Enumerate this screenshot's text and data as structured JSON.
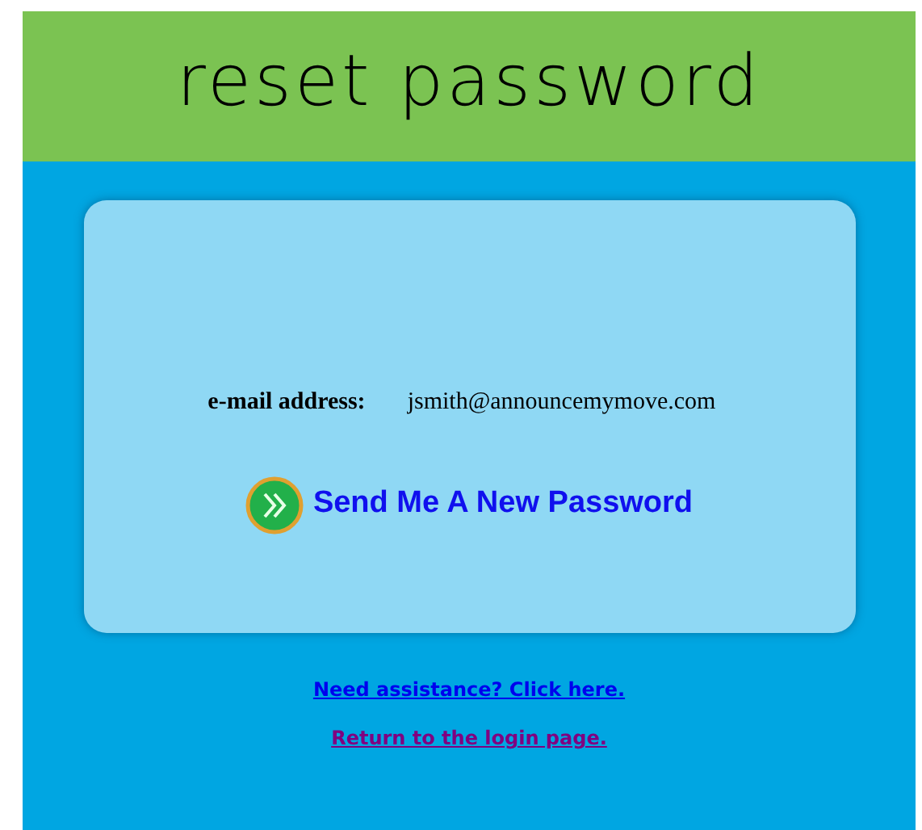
{
  "header": {
    "title": "reset password"
  },
  "form": {
    "label": "e-mail address:",
    "value": "jsmith@announcemymove.com",
    "submit": "Send Me A New Password"
  },
  "links": [
    {
      "text": "Need assistance? Click here.",
      "visited": false
    },
    {
      "text": "Return to the login page.",
      "visited": true
    }
  ]
}
